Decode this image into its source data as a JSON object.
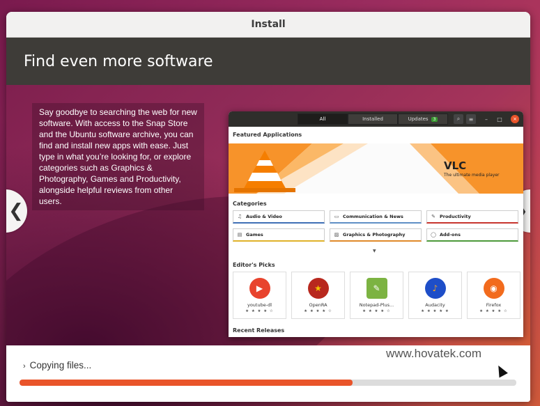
{
  "window": {
    "title": "Install"
  },
  "heading": "Find even more software",
  "description": "Say goodbye to searching the web for new software. With access to the Snap Store and the Ubuntu software archive, you can find and install new apps with ease. Just type in what you’re looking for, or explore categories such as Graphics & Photography, Games and Productivity, alongside helpful reviews from other users.",
  "nav": {
    "prev": "❮",
    "next": "❯"
  },
  "software": {
    "tabs": [
      {
        "label": "All"
      },
      {
        "label": "Installed"
      },
      {
        "label": "Updates",
        "badge": "3"
      }
    ],
    "featured_title": "Featured Applications",
    "banner": {
      "title": "VLC",
      "subtitle": "The ultimate media player"
    },
    "categories_title": "Categories",
    "categories": [
      {
        "label": "Audio & Video",
        "icon": "music-note-icon",
        "glyph": "♫",
        "color": "#3f6fb5"
      },
      {
        "label": "Communication & News",
        "icon": "chat-icon",
        "glyph": "▭",
        "color": "#5f8fc5"
      },
      {
        "label": "Productivity",
        "icon": "pencil-icon",
        "glyph": "✎",
        "color": "#c7342d"
      },
      {
        "label": "Games",
        "icon": "gamepad-icon",
        "glyph": "▤",
        "color": "#e0b22a"
      },
      {
        "label": "Graphics & Photography",
        "icon": "picture-icon",
        "glyph": "▨",
        "color": "#e08a2a"
      },
      {
        "label": "Add-ons",
        "icon": "chat-bubble-icon",
        "glyph": "◯",
        "color": "#4c9a3a"
      }
    ],
    "editors_title": "Editor's Picks",
    "picks": [
      {
        "name": "youtube-dl",
        "stars": "★ ★ ★ ★ ☆",
        "icon": "youtube-icon",
        "glyph": "▶",
        "color": "#e8432d"
      },
      {
        "name": "OpenRA",
        "stars": "★ ★ ★ ★ ☆",
        "icon": "hammer-sickle-icon",
        "glyph": "★",
        "color": "#b8281e"
      },
      {
        "name": "Notepad-Plus...",
        "stars": "★ ★ ★ ★ ☆",
        "icon": "notepad-icon",
        "glyph": "✎",
        "color": "#7cb342"
      },
      {
        "name": "Audacity",
        "stars": "★ ★ ★ ★ ★",
        "icon": "headphones-icon",
        "glyph": "♪",
        "color": "#1e4ec8"
      },
      {
        "name": "Firefox",
        "stars": "★ ★ ★ ★ ☆",
        "icon": "firefox-icon",
        "glyph": "◉",
        "color": "#f26b1d"
      }
    ],
    "recent_title": "Recent Releases"
  },
  "watermark": "www.hovatek.com",
  "status": "Copying files...",
  "progress": 0.67
}
